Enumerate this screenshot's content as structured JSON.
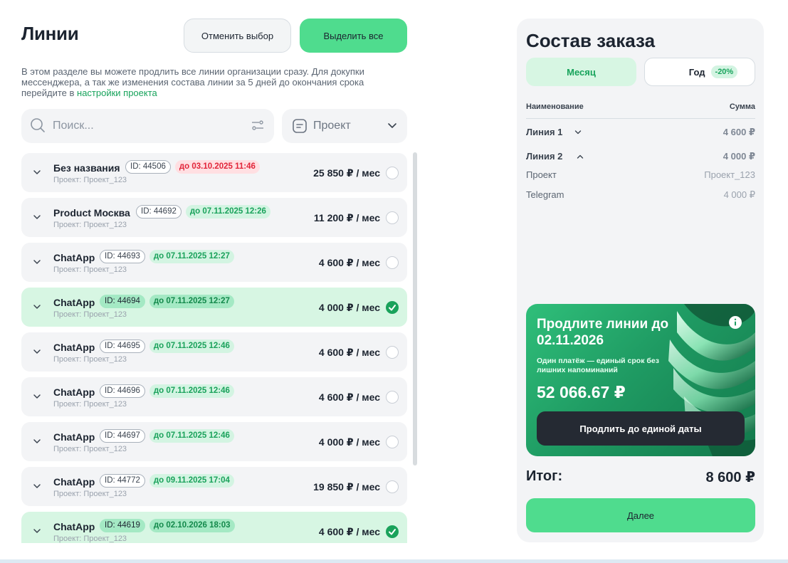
{
  "lines": {
    "title": "Линии",
    "cancel_label": "Отменить выбор",
    "select_all_label": "Выделить все",
    "description": "В этом разделе вы можете продлить все линии организации сразу. Для докупки мессенджера, а так же изменения состава линии за 5 дней до окончания срока перейдите в ",
    "settings_link": "настройки проекта",
    "search_placeholder": "Поиск...",
    "project_filter_label": "Проект",
    "items": [
      {
        "name": "Без названия",
        "id": "ID: 44506",
        "date": "до 03.10.2025 11:46",
        "date_status": "red",
        "project": "Проект: Проект_123",
        "price": "25 850 ₽ / мес",
        "selected": false
      },
      {
        "name": "Product Москва",
        "id": "ID: 44692",
        "date": "до 07.11.2025 12:26",
        "date_status": "green",
        "project": "Проект: Проект_123",
        "price": "11 200 ₽ / мес",
        "selected": false
      },
      {
        "name": "ChatApp",
        "id": "ID: 44693",
        "date": "до 07.11.2025 12:27",
        "date_status": "green",
        "project": "Проект: Проект_123",
        "price": "4 600 ₽ / мес",
        "selected": false
      },
      {
        "name": "ChatApp",
        "id": "ID: 44694",
        "date": "до 07.11.2025 12:27",
        "date_status": "green",
        "project": "Проект: Проект_123",
        "price": "4 000 ₽ / мес",
        "selected": true
      },
      {
        "name": "ChatApp",
        "id": "ID: 44695",
        "date": "до 07.11.2025 12:46",
        "date_status": "green",
        "project": "Проект: Проект_123",
        "price": "4 600 ₽ / мес",
        "selected": false
      },
      {
        "name": "ChatApp",
        "id": "ID: 44696",
        "date": "до 07.11.2025 12:46",
        "date_status": "green",
        "project": "Проект: Проект_123",
        "price": "4 600 ₽ / мес",
        "selected": false
      },
      {
        "name": "ChatApp",
        "id": "ID: 44697",
        "date": "до 07.11.2025 12:46",
        "date_status": "green",
        "project": "Проект: Проект_123",
        "price": "4 000 ₽ / мес",
        "selected": false
      },
      {
        "name": "ChatApp",
        "id": "ID: 44772",
        "date": "до 09.11.2025 17:04",
        "date_status": "green",
        "project": "Проект: Проект_123",
        "price": "19 850 ₽ / мес",
        "selected": false
      },
      {
        "name": "ChatApp",
        "id": "ID: 44619",
        "date": "до 02.10.2026 18:03",
        "date_status": "green",
        "project": "Проект: Проект_123",
        "price": "4 600 ₽ / мес",
        "selected": true
      }
    ]
  },
  "order": {
    "title": "Состав заказа",
    "period_month": "Месяц",
    "period_year": "Год",
    "year_discount": "-20%",
    "col_name": "Наименование",
    "col_sum": "Сумма",
    "line1_name": "Линия 1",
    "line1_sum": "4 600 ₽",
    "line2_name": "Линия 2",
    "line2_sum": "4 000 ₽",
    "line2_detail_project_label": "Проект",
    "line2_detail_project_value": "Проект_123",
    "line2_detail_messenger_label": "Telegram",
    "line2_detail_messenger_value": "4 000 ₽",
    "total_label": "Итог:",
    "total_value": "8 600 ₽",
    "next_label": "Далее"
  },
  "promo": {
    "title": "Продлите линии до 02.11.2026",
    "text": "Один платёж — единый срок без лишних напоминаний",
    "price": "52 066.67 ₽",
    "button_label": "Продлить до единой даты"
  },
  "colors": {
    "accent_green": "#4fdc8e",
    "selected_row": "#d7f6e3",
    "expired_red": "#e2253a"
  }
}
